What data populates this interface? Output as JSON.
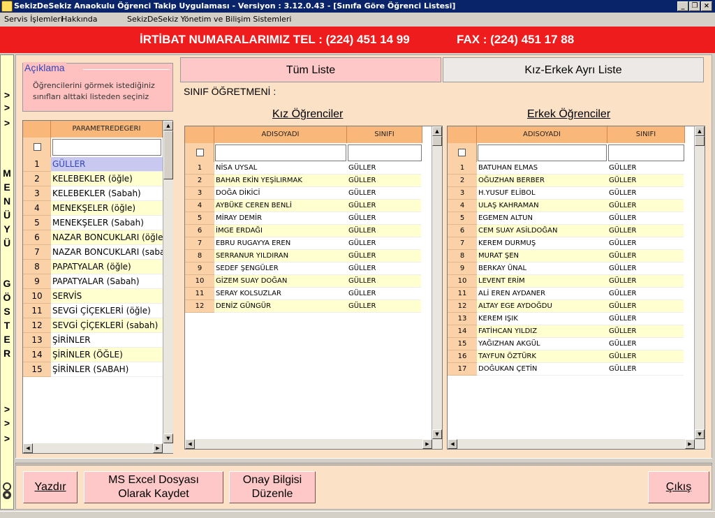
{
  "window": {
    "title": "SekizDeSekiz Anaokulu Öğrenci Takip Uygulaması - Versiyon : 3.12.0.43 - [Sınıfa Göre Öğrenci Listesi]"
  },
  "menu": {
    "servis": "Servis İşlemleri",
    "hakkinda": "Hakkında",
    "system": "SekizDeSekiz Yönetim ve Bilişim Sistemleri"
  },
  "banner": {
    "tel": "İRTİBAT NUMARALARIMIZ  TEL : (224) 451 14 99",
    "fax": "FAX : (224) 451 17 88"
  },
  "sidebar": {
    "letters": [
      ">",
      ">",
      ">",
      "M",
      "E",
      "N",
      "Ü",
      "Y",
      "Ü",
      "G",
      "Ö",
      "S",
      "T",
      "E",
      "R",
      ">",
      ">",
      ">"
    ]
  },
  "aciklama": {
    "title": "Açıklama",
    "text": "Öğrencilerini görmek istediğiniz sınıfları alttaki listeden seçiniz"
  },
  "param": {
    "header": "PARAMETREDEGERI",
    "rows": [
      {
        "no": "1",
        "name": "GÜLLER"
      },
      {
        "no": "2",
        "name": "KELEBEKLER (öğle)"
      },
      {
        "no": "3",
        "name": "KELEBEKLER (Sabah)"
      },
      {
        "no": "4",
        "name": "MENEKŞELER (öğle)"
      },
      {
        "no": "5",
        "name": "MENEKŞELER (Sabah)"
      },
      {
        "no": "6",
        "name": "NAZAR BONCUKLARI (öğle)"
      },
      {
        "no": "7",
        "name": "NAZAR BONCUKLARI (sabah)"
      },
      {
        "no": "8",
        "name": "PAPATYALAR (öğle)"
      },
      {
        "no": "9",
        "name": "PAPATYALAR (Sabah)"
      },
      {
        "no": "10",
        "name": "SERVİS"
      },
      {
        "no": "11",
        "name": "SEVGİ ÇİÇEKLERİ (öğle)"
      },
      {
        "no": "12",
        "name": "SEVGİ ÇİÇEKLERİ (sabah)"
      },
      {
        "no": "13",
        "name": "ŞİRİNLER"
      },
      {
        "no": "14",
        "name": "ŞİRİNLER (ÖĞLE)"
      },
      {
        "no": "15",
        "name": "ŞİRİNLER (SABAH)"
      }
    ]
  },
  "tabs": {
    "all": "Tüm Liste",
    "split": "Kız-Erkek Ayrı Liste"
  },
  "teacher": "SINIF ÖĞRETMENİ :",
  "girls": {
    "title": "Kız Öğrenciler",
    "h_name": "ADISOYADI",
    "h_class": "SINIFI",
    "rows": [
      {
        "no": "1",
        "name": "NİSA  UYSAL",
        "cls": "GÜLLER"
      },
      {
        "no": "2",
        "name": "BAHAR EKİN YEŞİLIRMAK",
        "cls": "GÜLLER"
      },
      {
        "no": "3",
        "name": "DOĞA DİKİCİ",
        "cls": "GÜLLER"
      },
      {
        "no": "4",
        "name": "AYBÜKE CEREN BENLİ",
        "cls": "GÜLLER"
      },
      {
        "no": "5",
        "name": "MİRAY DEMİR",
        "cls": "GÜLLER"
      },
      {
        "no": "6",
        "name": "İMGE ERDAĞI",
        "cls": "GÜLLER"
      },
      {
        "no": "7",
        "name": "EBRU RUGAYYA EREN",
        "cls": "GÜLLER"
      },
      {
        "no": "8",
        "name": "SERRANUR YILDIRAN",
        "cls": "GÜLLER"
      },
      {
        "no": "9",
        "name": "SEDEF  ŞENGÜLER",
        "cls": "GÜLLER"
      },
      {
        "no": "10",
        "name": "GİZEM SUAY DOĞAN",
        "cls": "GÜLLER"
      },
      {
        "no": "11",
        "name": "SERAY  KOLSUZLAR",
        "cls": "GÜLLER"
      },
      {
        "no": "12",
        "name": "DENİZ GÜNGÜR",
        "cls": "GÜLLER"
      }
    ]
  },
  "boys": {
    "title": "Erkek Öğrenciler",
    "h_name": "ADISOYADI",
    "h_class": "SINIFI",
    "rows": [
      {
        "no": "1",
        "name": "BATUHAN ELMAS",
        "cls": "GÜLLER"
      },
      {
        "no": "2",
        "name": "OĞUZHAN BERBER",
        "cls": "GÜLLER"
      },
      {
        "no": "3",
        "name": "H.YUSUF ELİBOL",
        "cls": "GÜLLER"
      },
      {
        "no": "4",
        "name": "ULAŞ KAHRAMAN",
        "cls": "GÜLLER"
      },
      {
        "no": "5",
        "name": "EGEMEN  ALTUN",
        "cls": "GÜLLER"
      },
      {
        "no": "6",
        "name": "CEM SUAY ASİLDOĞAN",
        "cls": "GÜLLER"
      },
      {
        "no": "7",
        "name": "KEREM  DURMUŞ",
        "cls": "GÜLLER"
      },
      {
        "no": "8",
        "name": "MURAT ŞEN",
        "cls": "GÜLLER"
      },
      {
        "no": "9",
        "name": "BERKAY ÜNAL",
        "cls": "GÜLLER"
      },
      {
        "no": "10",
        "name": "LEVENT ERİM",
        "cls": "GÜLLER"
      },
      {
        "no": "11",
        "name": "ALİ EREN AYDANER",
        "cls": "GÜLLER"
      },
      {
        "no": "12",
        "name": "ALTAY EGE AYDOĞDU",
        "cls": "GÜLLER"
      },
      {
        "no": "13",
        "name": "KEREM  IŞIK",
        "cls": "GÜLLER"
      },
      {
        "no": "14",
        "name": "FATİHCAN YILDIZ",
        "cls": "GÜLLER"
      },
      {
        "no": "15",
        "name": "YAĞIZHAN AKGÜL",
        "cls": "GÜLLER"
      },
      {
        "no": "16",
        "name": "TAYFUN ÖZTÜRK",
        "cls": "GÜLLER"
      },
      {
        "no": "17",
        "name": "DOĞUKAN ÇETİN",
        "cls": "GÜLLER"
      }
    ]
  },
  "buttons": {
    "print": "Yazdır",
    "excel1": "MS Excel Dosyası",
    "excel2": "Olarak Kaydet",
    "onay1": "Onay Bilgisi",
    "onay2": "Düzenle",
    "exit": "Çıkış"
  },
  "colors": {
    "title_bar": "#0a246a",
    "banner": "#ee1c1c",
    "panel": "#fbe2c6",
    "header": "#f9b87a",
    "row_alt": "#ffffd0",
    "selected": "#c8c8f0",
    "button": "#ffc8c8"
  },
  "icons": {
    "sidebar_bottom": "gear-icon",
    "checkbox": "checkbox-icon"
  }
}
